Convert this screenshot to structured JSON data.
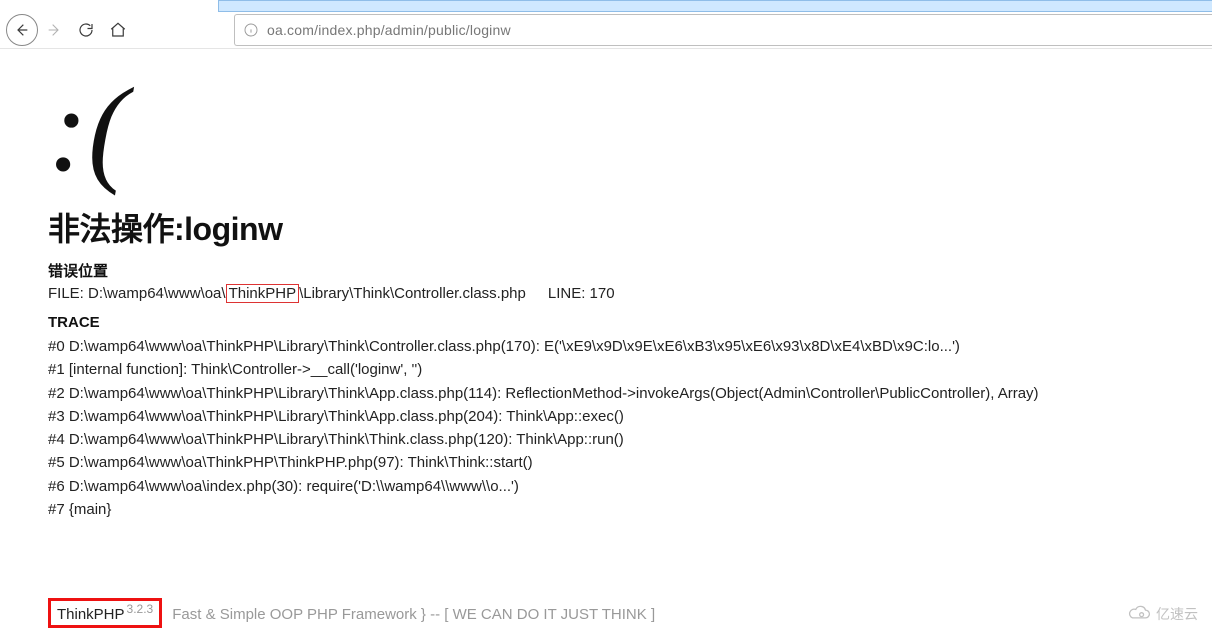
{
  "browser": {
    "url": "oa.com/index.php/admin/public/loginw"
  },
  "error": {
    "emoticon": ":(",
    "headline": "非法操作:loginw",
    "location_label": "错误位置",
    "file_prefix": "FILE: D:\\wamp64\\www\\oa\\",
    "file_highlight": "ThinkPHP",
    "file_suffix": "\\Library\\Think\\Controller.class.php",
    "line_label": "LINE: 170",
    "trace_label": "TRACE",
    "trace": [
      "#0 D:\\wamp64\\www\\oa\\ThinkPHP\\Library\\Think\\Controller.class.php(170): E('\\xE9\\x9D\\x9E\\xE6\\xB3\\x95\\xE6\\x93\\x8D\\xE4\\xBD\\x9C:lo...')",
      "#1 [internal function]: Think\\Controller->__call('loginw', '')",
      "#2 D:\\wamp64\\www\\oa\\ThinkPHP\\Library\\Think\\App.class.php(114): ReflectionMethod->invokeArgs(Object(Admin\\Controller\\PublicController), Array)",
      "#3 D:\\wamp64\\www\\oa\\ThinkPHP\\Library\\Think\\App.class.php(204): Think\\App::exec()",
      "#4 D:\\wamp64\\www\\oa\\ThinkPHP\\Library\\Think\\Think.class.php(120): Think\\App::run()",
      "#5 D:\\wamp64\\www\\oa\\ThinkPHP\\ThinkPHP.php(97): Think\\Think::start()",
      "#6 D:\\wamp64\\www\\oa\\index.php(30): require('D:\\\\wamp64\\\\www\\\\o...')",
      "#7 {main}"
    ]
  },
  "footer": {
    "product": "ThinkPHP",
    "version": "3.2.3",
    "tagline": "Fast & Simple OOP PHP Framework } -- [ WE CAN DO IT JUST THINK ]"
  },
  "watermark": "亿速云"
}
